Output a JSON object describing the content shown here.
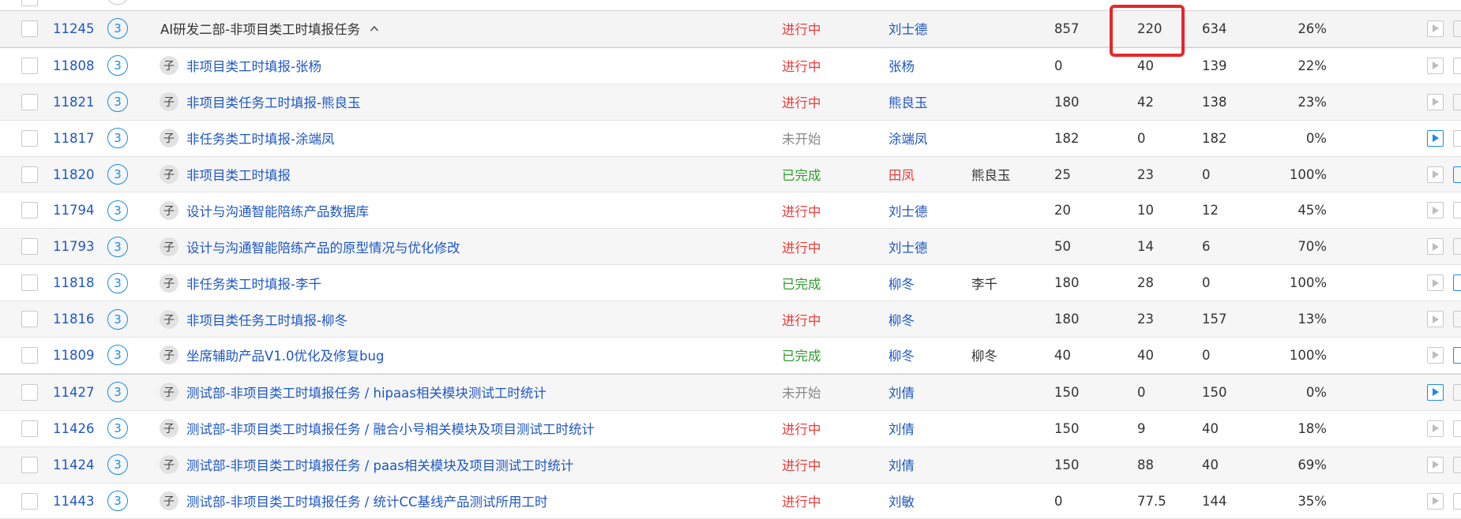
{
  "colors": {
    "link": "#1f57c3",
    "in_progress": "#e8403e",
    "not_started": "#8a8a8a",
    "completed": "#2f9e2f",
    "highlight": "#e8262a",
    "accent": "#1a8ce6"
  },
  "rows": [
    {
      "id": "11245",
      "level": "3",
      "is_parent": true,
      "sub": "",
      "title": "AI研发二部-非项目类工时填报任务",
      "status": "进行中",
      "status_key": "in_progress",
      "owner": "刘士德",
      "owner_color": "#1f57c3",
      "assistant": "",
      "total": "857",
      "done": "220",
      "remaining": "634",
      "percent": "26%",
      "action_active": false
    },
    {
      "id": "11808",
      "level": "3",
      "is_parent": false,
      "sub": "子",
      "title": "非项目类工时填报-张杨",
      "status": "进行中",
      "status_key": "in_progress",
      "owner": "张杨",
      "owner_color": "#1f57c3",
      "assistant": "",
      "total": "0",
      "done": "40",
      "remaining": "139",
      "percent": "22%",
      "action_active": false
    },
    {
      "id": "11821",
      "level": "3",
      "is_parent": false,
      "sub": "子",
      "title": "非项目类任务工时填报-熊良玉",
      "status": "进行中",
      "status_key": "in_progress",
      "owner": "熊良玉",
      "owner_color": "#1f57c3",
      "assistant": "",
      "total": "180",
      "done": "42",
      "remaining": "138",
      "percent": "23%",
      "action_active": false
    },
    {
      "id": "11817",
      "level": "3",
      "is_parent": false,
      "sub": "子",
      "title": "非任务类工时填报-涂端凤",
      "status": "未开始",
      "status_key": "not_started",
      "owner": "涂端凤",
      "owner_color": "#1f57c3",
      "assistant": "",
      "total": "182",
      "done": "0",
      "remaining": "182",
      "percent": "0%",
      "action_active": true
    },
    {
      "id": "11820",
      "level": "3",
      "is_parent": false,
      "sub": "子",
      "title": "非项目类工时填报",
      "status": "已完成",
      "status_key": "completed",
      "owner": "田凤",
      "owner_color": "#e8403e",
      "assistant": "熊良玉",
      "total": "25",
      "done": "23",
      "remaining": "0",
      "percent": "100%",
      "action_active": false
    },
    {
      "id": "11794",
      "level": "3",
      "is_parent": false,
      "sub": "子",
      "title": "设计与沟通智能陪练产品数据库",
      "status": "进行中",
      "status_key": "in_progress",
      "owner": "刘士德",
      "owner_color": "#1f57c3",
      "assistant": "",
      "total": "20",
      "done": "10",
      "remaining": "12",
      "percent": "45%",
      "action_active": false
    },
    {
      "id": "11793",
      "level": "3",
      "is_parent": false,
      "sub": "子",
      "title": "设计与沟通智能陪练产品的原型情况与优化修改",
      "status": "进行中",
      "status_key": "in_progress",
      "owner": "刘士德",
      "owner_color": "#1f57c3",
      "assistant": "",
      "total": "50",
      "done": "14",
      "remaining": "6",
      "percent": "70%",
      "action_active": false
    },
    {
      "id": "11818",
      "level": "3",
      "is_parent": false,
      "sub": "子",
      "title": "非任务类工时填报-李千",
      "status": "已完成",
      "status_key": "completed",
      "owner": "柳冬",
      "owner_color": "#1f57c3",
      "assistant": "李千",
      "total": "180",
      "done": "28",
      "remaining": "0",
      "percent": "100%",
      "action_active": false
    },
    {
      "id": "11816",
      "level": "3",
      "is_parent": false,
      "sub": "子",
      "title": "非项目类任务工时填报-柳冬",
      "status": "进行中",
      "status_key": "in_progress",
      "owner": "柳冬",
      "owner_color": "#1f57c3",
      "assistant": "",
      "total": "180",
      "done": "23",
      "remaining": "157",
      "percent": "13%",
      "action_active": false
    },
    {
      "id": "11809",
      "level": "3",
      "is_parent": false,
      "sub": "子",
      "title": "坐席辅助产品V1.0优化及修复bug",
      "status": "已完成",
      "status_key": "completed",
      "owner": "柳冬",
      "owner_color": "#1f57c3",
      "assistant": "柳冬",
      "total": "40",
      "done": "40",
      "remaining": "0",
      "percent": "100%",
      "action_active": false
    },
    {
      "id": "11427",
      "level": "3",
      "is_parent": false,
      "sub": "子",
      "title": "测试部-非项目类工时填报任务 / hipaas相关模块测试工时统计",
      "status": "未开始",
      "status_key": "not_started",
      "owner": "刘倩",
      "owner_color": "#1f57c3",
      "assistant": "",
      "total": "150",
      "done": "0",
      "remaining": "150",
      "percent": "0%",
      "action_active": true
    },
    {
      "id": "11426",
      "level": "3",
      "is_parent": false,
      "sub": "子",
      "title": "测试部-非项目类工时填报任务 / 融合小号相关模块及项目测试工时统计",
      "status": "进行中",
      "status_key": "in_progress",
      "owner": "刘倩",
      "owner_color": "#1f57c3",
      "assistant": "",
      "total": "150",
      "done": "9",
      "remaining": "40",
      "percent": "18%",
      "action_active": false
    },
    {
      "id": "11424",
      "level": "3",
      "is_parent": false,
      "sub": "子",
      "title": "测试部-非项目类工时填报任务 / paas相关模块及项目测试工时统计",
      "status": "进行中",
      "status_key": "in_progress",
      "owner": "刘倩",
      "owner_color": "#1f57c3",
      "assistant": "",
      "total": "150",
      "done": "88",
      "remaining": "40",
      "percent": "69%",
      "action_active": false
    },
    {
      "id": "11443",
      "level": "3",
      "is_parent": false,
      "sub": "子",
      "title": "测试部-非项目类工时填报任务 / 统计CC基线产品测试所用工时",
      "status": "进行中",
      "status_key": "in_progress",
      "owner": "刘敏",
      "owner_color": "#1f57c3",
      "assistant": "",
      "total": "0",
      "done": "77.5",
      "remaining": "144",
      "percent": "35%",
      "action_active": false
    }
  ]
}
